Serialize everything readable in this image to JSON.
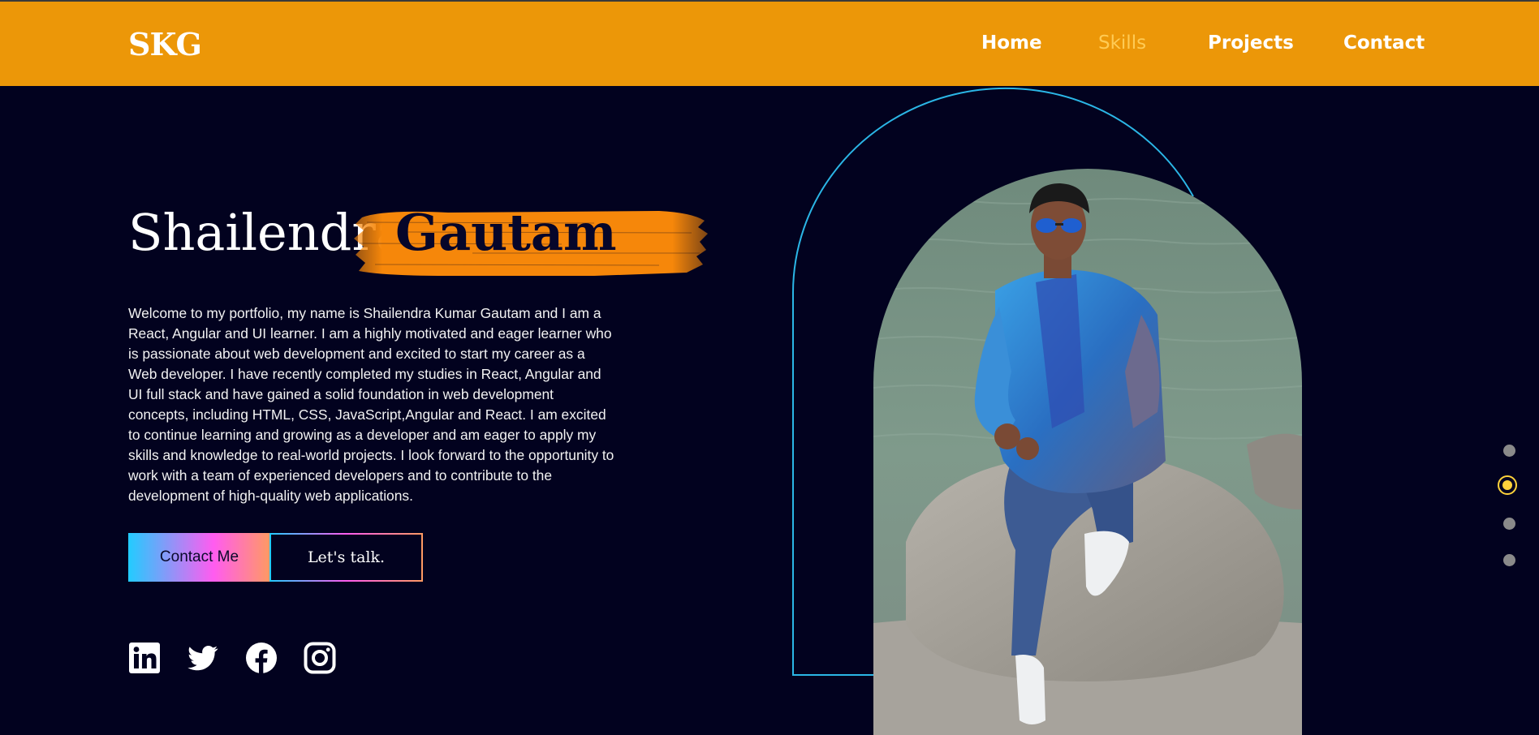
{
  "header": {
    "logo": "SKG",
    "nav": [
      {
        "label": "Home",
        "active": false
      },
      {
        "label": "Skills",
        "active": true
      },
      {
        "label": "Projects",
        "active": false
      },
      {
        "label": "Contact",
        "active": false
      }
    ]
  },
  "hero": {
    "first_name": "Shailendra",
    "last_name": "Gautam",
    "bio": "Welcome to my portfolio, my name is Shailendra Kumar Gautam and I am a React, Angular and UI learner. I am a highly motivated and eager learner who is passionate about web development and excited to start my career as a Web developer. I have recently completed my studies in React, Angular and UI full stack and have gained a solid foundation in web development concepts, including HTML, CSS, JavaScript,Angular and React. I am excited to continue learning and growing as a developer and am eager to apply my skills and knowledge to real-world projects. I look forward to the opportunity to work with a team of experienced developers and to contribute to the development of high-quality web applications.",
    "buttons": {
      "contact": "Contact Me",
      "talk": "Let's talk."
    },
    "socials": [
      "linkedin-icon",
      "twitter-icon",
      "facebook-icon",
      "instagram-icon"
    ]
  },
  "slider": {
    "count": 4,
    "active_index": 1
  },
  "colors": {
    "header_bg": "#ec9708",
    "page_bg": "#02021f",
    "accent_orange": "#f6870a",
    "arch_line": "#2bb6e6",
    "active_nav": "#ffcb55",
    "active_dot": "#ffd23b"
  }
}
